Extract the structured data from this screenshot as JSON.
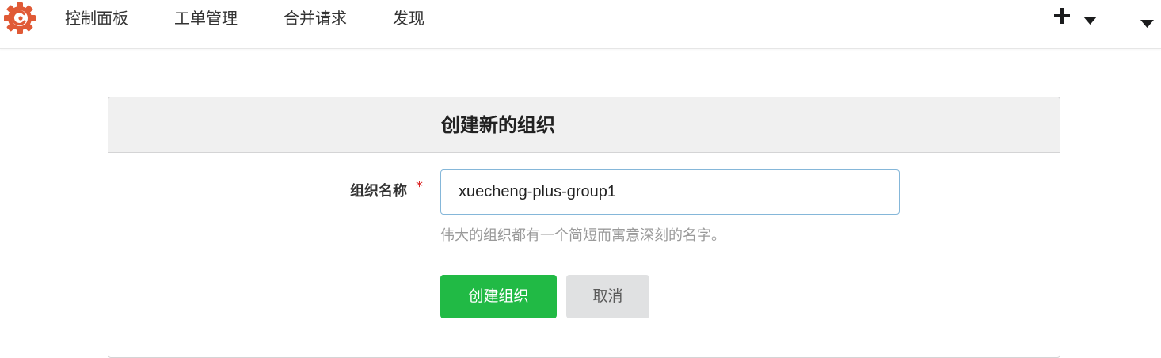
{
  "nav": {
    "logo_icon": "gitea-logo-icon",
    "items": [
      {
        "label": "控制面板"
      },
      {
        "label": "工单管理"
      },
      {
        "label": "合并请求"
      },
      {
        "label": "发现"
      }
    ],
    "create_icon": "plus-icon",
    "dropdown_icon": "caret-down-icon"
  },
  "form": {
    "title": "创建新的组织",
    "org_name_label": "组织名称",
    "required_mark": "*",
    "org_name_value": "xuecheng-plus-group1",
    "help_text": "伟大的组织都有一个简短而寓意深刻的名字。",
    "create_button": "创建组织",
    "cancel_button": "取消"
  },
  "colors": {
    "logo": "#e05a36",
    "primary_button": "#21ba45",
    "secondary_button": "#e0e1e2",
    "required": "#db2828",
    "input_focus_border": "#85b7d9"
  }
}
